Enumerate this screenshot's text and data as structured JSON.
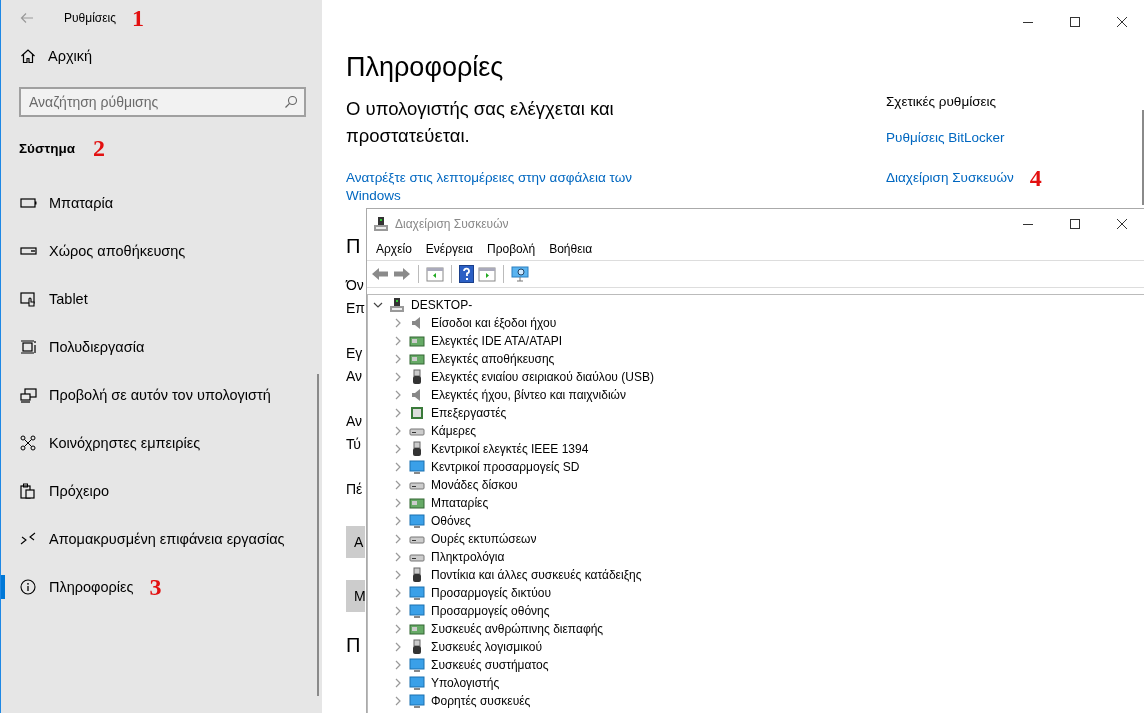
{
  "settings": {
    "title": "Ρυθμίσεις",
    "title_mark": "1",
    "home": "Αρχική",
    "search": {
      "placeholder": "Αναζήτηση ρύθμισης"
    },
    "section": "Σύστημα",
    "section_mark": "2",
    "items": [
      {
        "label": "Μπαταρία",
        "selected": false
      },
      {
        "label": "Χώρος αποθήκευσης",
        "selected": false
      },
      {
        "label": "Tablet",
        "selected": false
      },
      {
        "label": "Πολυδιεργασία",
        "selected": false
      },
      {
        "label": "Προβολή σε αυτόν τον υπολογιστή",
        "selected": false
      },
      {
        "label": "Κοινόχρηστες εμπειρίες",
        "selected": false
      },
      {
        "label": "Πρόχειρο",
        "selected": false
      },
      {
        "label": "Απομακρυσμένη επιφάνεια εργασίας",
        "selected": false
      },
      {
        "label": "Πληροφορίες",
        "selected": true,
        "mark": "3"
      }
    ],
    "page": {
      "heading": "Πληροφορίες",
      "status": "Ο υπολογιστής σας ελέγχεται και προστατεύεται.",
      "security_link": "Ανατρέξτε στις λεπτομέρειες στην ασφάλεια των Windows",
      "partial": [
        {
          "kind": "heading",
          "text": "Π"
        },
        {
          "kind": "line",
          "text": "Όν"
        },
        {
          "kind": "line",
          "text": "Επ"
        },
        {
          "kind": "gap"
        },
        {
          "kind": "line",
          "text": "Εγ"
        },
        {
          "kind": "line",
          "text": "Αν"
        },
        {
          "kind": "gap"
        },
        {
          "kind": "line",
          "text": "Αν"
        },
        {
          "kind": "line",
          "text": "Τύ"
        },
        {
          "kind": "gap"
        },
        {
          "kind": "line",
          "text": "Πέ"
        },
        {
          "kind": "gap"
        },
        {
          "kind": "button",
          "text": "Α"
        },
        {
          "kind": "button",
          "text": "Μ"
        },
        {
          "kind": "heading",
          "text": "Π"
        }
      ]
    },
    "related": {
      "title": "Σχετικές ρυθμίσεις",
      "links": [
        {
          "label": "Ρυθμίσεις BitLocker"
        },
        {
          "label": "Διαχείριση Συσκευών",
          "mark": "4"
        }
      ]
    }
  },
  "device_manager": {
    "title": "Διαχείριση Συσκευών",
    "menu": [
      "Αρχείο",
      "Ενέργεια",
      "Προβολή",
      "Βοήθεια"
    ],
    "tree": {
      "label": "DESKTOP-",
      "expanded": true,
      "children": [
        {
          "label": "Είσοδοι και έξοδοι ήχου",
          "expanded": false
        },
        {
          "label": "Ελεγκτές IDE ATA/ATAPI",
          "expanded": false
        },
        {
          "label": "Ελεγκτές αποθήκευσης",
          "expanded": false
        },
        {
          "label": "Ελεγκτές ενιαίου σειριακού διαύλου (USB)",
          "expanded": false
        },
        {
          "label": "Ελεγκτές ήχου, βίντεο και παιχνιδιών",
          "expanded": false
        },
        {
          "label": "Επεξεργαστές",
          "expanded": false
        },
        {
          "label": "Κάμερες",
          "expanded": false
        },
        {
          "label": "Κεντρικοί ελεγκτές IEEE 1394",
          "expanded": false
        },
        {
          "label": "Κεντρικοί προσαρμογείς SD",
          "expanded": false
        },
        {
          "label": "Μονάδες δίσκου",
          "expanded": false
        },
        {
          "label": "Μπαταρίες",
          "expanded": false
        },
        {
          "label": "Οθόνες",
          "expanded": false
        },
        {
          "label": "Ουρές εκτυπώσεων",
          "expanded": false
        },
        {
          "label": "Πληκτρολόγια",
          "expanded": false
        },
        {
          "label": "Ποντίκια και άλλες συσκευές κατάδειξης",
          "expanded": false
        },
        {
          "label": "Προσαρμογείς δικτύου",
          "expanded": false
        },
        {
          "label": "Προσαρμογείς οθόνης",
          "expanded": false
        },
        {
          "label": "Συσκευές ανθρώπινης διεπαφής",
          "expanded": false
        },
        {
          "label": "Συσκευές λογισμικού",
          "expanded": false
        },
        {
          "label": "Συσκευές συστήματος",
          "expanded": false
        },
        {
          "label": "Υπολογιστής",
          "expanded": false
        },
        {
          "label": "Φορητές συσκευές",
          "expanded": false
        }
      ]
    }
  }
}
